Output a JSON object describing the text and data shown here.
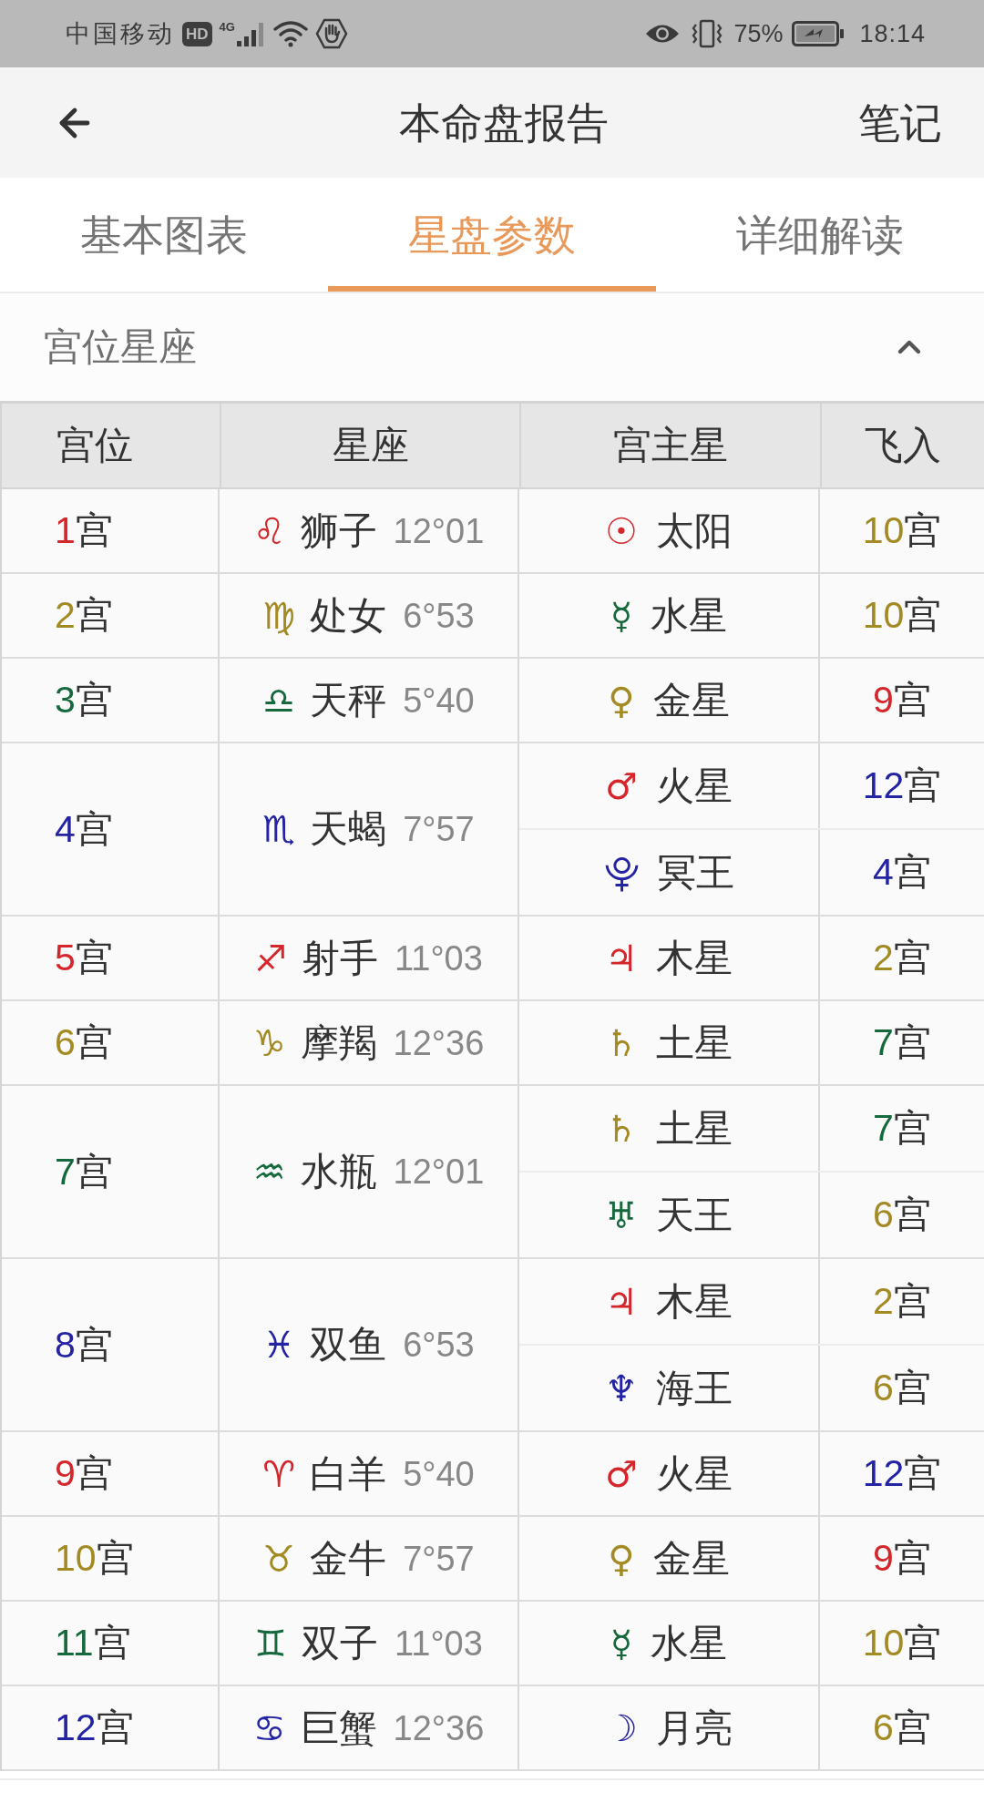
{
  "status_bar": {
    "carrier": "中国移动",
    "hd_badge": "HD",
    "network": "4G",
    "battery_percent": "75%",
    "time": "18:14"
  },
  "header": {
    "title": "本命盘报告",
    "action": "笔记"
  },
  "tabs": [
    {
      "label": "基本图表",
      "selected": false
    },
    {
      "label": "星盘参数",
      "selected": true
    },
    {
      "label": "详细解读",
      "selected": false
    }
  ],
  "section": {
    "title": "宫位星座",
    "expanded": true
  },
  "table": {
    "columns": [
      "宫位",
      "星座",
      "宫主星",
      "飞入"
    ],
    "rows": [
      {
        "house": {
          "number": "1",
          "unit": "宫",
          "color": "#d4262b"
        },
        "sign": {
          "symbol": "♌",
          "color": "#d4262b",
          "name": "狮子",
          "degree": "12°01"
        },
        "rulers": [
          {
            "symbol": "☉",
            "color": "#d4262b",
            "name": "太阳",
            "flies_into": {
              "number": "10",
              "unit": "宫",
              "color": "#a38a22"
            }
          }
        ]
      },
      {
        "house": {
          "number": "2",
          "unit": "宫",
          "color": "#a38a22"
        },
        "sign": {
          "symbol": "♍",
          "color": "#a38a22",
          "name": "处女",
          "degree": "6°53"
        },
        "rulers": [
          {
            "symbol": "☿",
            "color": "#15693c",
            "name": "水星",
            "flies_into": {
              "number": "10",
              "unit": "宫",
              "color": "#a38a22"
            }
          }
        ]
      },
      {
        "house": {
          "number": "3",
          "unit": "宫",
          "color": "#15693c"
        },
        "sign": {
          "symbol": "♎",
          "color": "#15693c",
          "name": "天秤",
          "degree": "5°40"
        },
        "rulers": [
          {
            "symbol": "♀",
            "color": "#a38a22",
            "name": "金星",
            "flies_into": {
              "number": "9",
              "unit": "宫",
              "color": "#d4262b"
            }
          }
        ]
      },
      {
        "house": {
          "number": "4",
          "unit": "宫",
          "color": "#2323a3"
        },
        "sign": {
          "symbol": "♏",
          "color": "#2323a3",
          "name": "天蝎",
          "degree": "7°57"
        },
        "rulers": [
          {
            "symbol": "♂",
            "color": "#d4262b",
            "name": "火星",
            "flies_into": {
              "number": "12",
              "unit": "宫",
              "color": "#2323a3"
            }
          },
          {
            "symbol": "⯓",
            "color": "#2323a3",
            "name": "冥王",
            "flies_into": {
              "number": "4",
              "unit": "宫",
              "color": "#2323a3"
            }
          }
        ]
      },
      {
        "house": {
          "number": "5",
          "unit": "宫",
          "color": "#d4262b"
        },
        "sign": {
          "symbol": "♐",
          "color": "#d4262b",
          "name": "射手",
          "degree": "11°03"
        },
        "rulers": [
          {
            "symbol": "♃",
            "color": "#d4262b",
            "name": "木星",
            "flies_into": {
              "number": "2",
              "unit": "宫",
              "color": "#a38a22"
            }
          }
        ]
      },
      {
        "house": {
          "number": "6",
          "unit": "宫",
          "color": "#a38a22"
        },
        "sign": {
          "symbol": "♑",
          "color": "#a38a22",
          "name": "摩羯",
          "degree": "12°36"
        },
        "rulers": [
          {
            "symbol": "♄",
            "color": "#a38a22",
            "name": "土星",
            "flies_into": {
              "number": "7",
              "unit": "宫",
              "color": "#15693c"
            }
          }
        ]
      },
      {
        "house": {
          "number": "7",
          "unit": "宫",
          "color": "#15693c"
        },
        "sign": {
          "symbol": "♒",
          "color": "#15693c",
          "name": "水瓶",
          "degree": "12°01"
        },
        "rulers": [
          {
            "symbol": "♄",
            "color": "#a38a22",
            "name": "土星",
            "flies_into": {
              "number": "7",
              "unit": "宫",
              "color": "#15693c"
            }
          },
          {
            "symbol": "♅",
            "color": "#15693c",
            "name": "天王",
            "flies_into": {
              "number": "6",
              "unit": "宫",
              "color": "#a38a22"
            }
          }
        ]
      },
      {
        "house": {
          "number": "8",
          "unit": "宫",
          "color": "#2323a3"
        },
        "sign": {
          "symbol": "♓",
          "color": "#2323a3",
          "name": "双鱼",
          "degree": "6°53"
        },
        "rulers": [
          {
            "symbol": "♃",
            "color": "#d4262b",
            "name": "木星",
            "flies_into": {
              "number": "2",
              "unit": "宫",
              "color": "#a38a22"
            }
          },
          {
            "symbol": "♆",
            "color": "#2323a3",
            "name": "海王",
            "flies_into": {
              "number": "6",
              "unit": "宫",
              "color": "#a38a22"
            }
          }
        ]
      },
      {
        "house": {
          "number": "9",
          "unit": "宫",
          "color": "#d4262b"
        },
        "sign": {
          "symbol": "♈",
          "color": "#d4262b",
          "name": "白羊",
          "degree": "5°40"
        },
        "rulers": [
          {
            "symbol": "♂",
            "color": "#d4262b",
            "name": "火星",
            "flies_into": {
              "number": "12",
              "unit": "宫",
              "color": "#2323a3"
            }
          }
        ]
      },
      {
        "house": {
          "number": "10",
          "unit": "宫",
          "color": "#a38a22"
        },
        "sign": {
          "symbol": "♉",
          "color": "#a38a22",
          "name": "金牛",
          "degree": "7°57"
        },
        "rulers": [
          {
            "symbol": "♀",
            "color": "#a38a22",
            "name": "金星",
            "flies_into": {
              "number": "9",
              "unit": "宫",
              "color": "#d4262b"
            }
          }
        ]
      },
      {
        "house": {
          "number": "11",
          "unit": "宫",
          "color": "#15693c"
        },
        "sign": {
          "symbol": "♊",
          "color": "#15693c",
          "name": "双子",
          "degree": "11°03"
        },
        "rulers": [
          {
            "symbol": "☿",
            "color": "#15693c",
            "name": "水星",
            "flies_into": {
              "number": "10",
              "unit": "宫",
              "color": "#a38a22"
            }
          }
        ]
      },
      {
        "house": {
          "number": "12",
          "unit": "宫",
          "color": "#2323a3"
        },
        "sign": {
          "symbol": "♋",
          "color": "#2323a3",
          "name": "巨蟹",
          "degree": "12°36"
        },
        "rulers": [
          {
            "symbol": "☽",
            "color": "#2323a3",
            "name": "月亮",
            "flies_into": {
              "number": "6",
              "unit": "宫",
              "color": "#a38a22"
            }
          }
        ]
      }
    ]
  }
}
